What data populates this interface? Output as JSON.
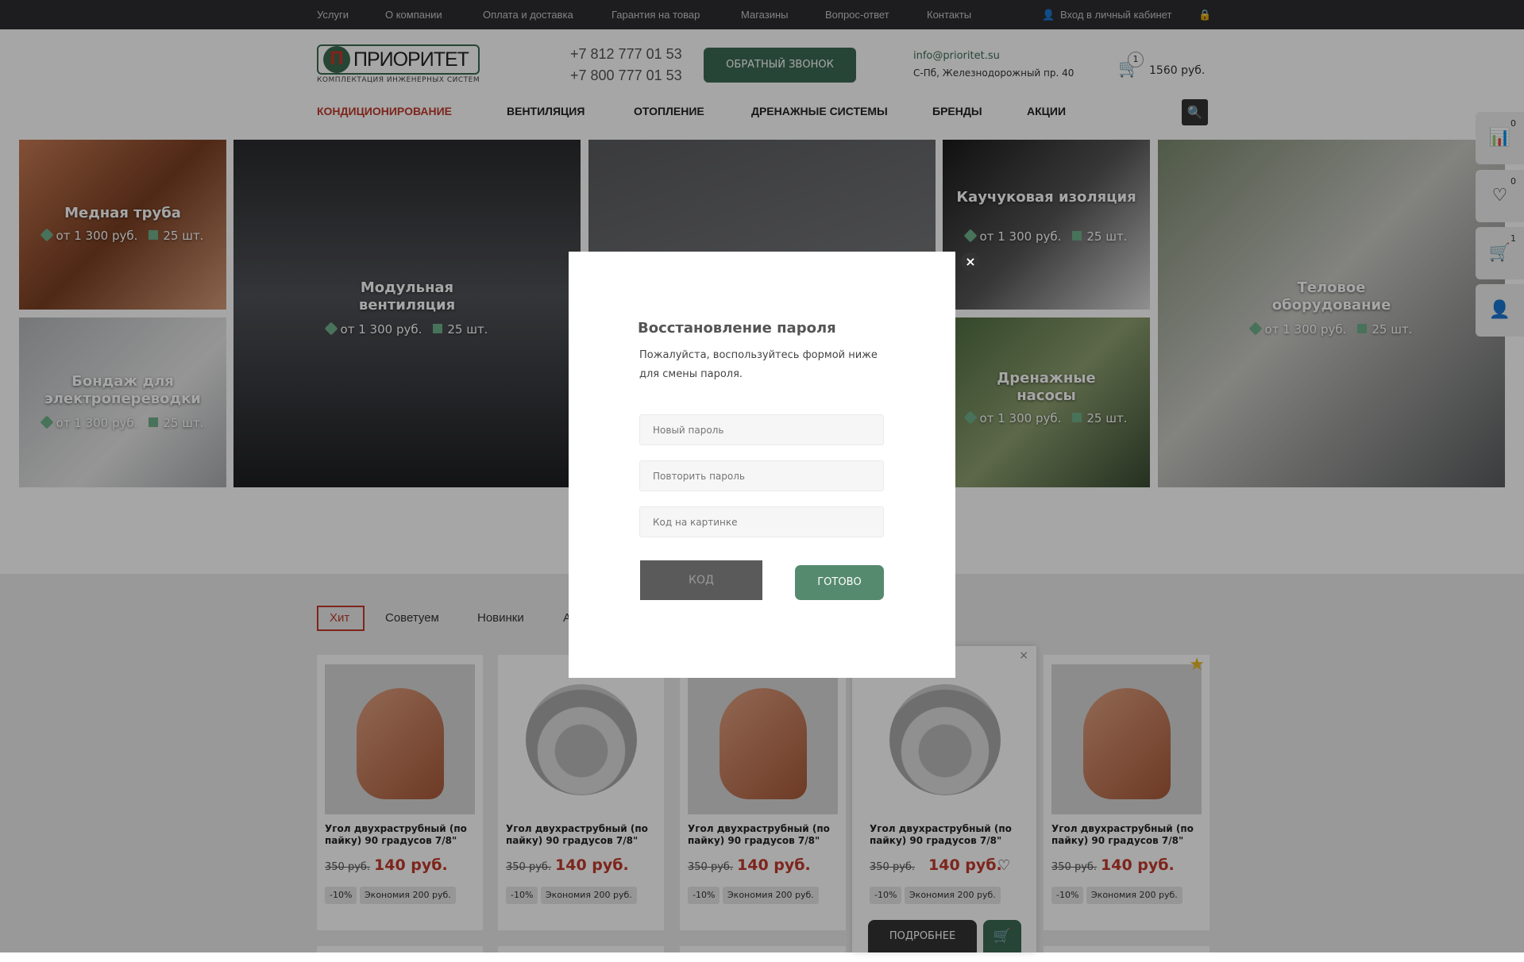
{
  "topbar": {
    "links": [
      "Услуги",
      "О компании",
      "Оплата и доставка",
      "Гарантия на товар",
      "Магазины",
      "Вопрос-ответ",
      "Контакты"
    ],
    "login": "Вход в личный кабинет"
  },
  "header": {
    "logo_mark": "П",
    "logo_text": "ПРИОРИТЕТ",
    "tagline": "КОМПЛЕКТАЦИЯ ИНЖЕНЕРНЫХ СИСТЕМ",
    "phones": [
      "+7 812 777 01 53",
      "+7 800 777 01 53"
    ],
    "callback": "ОБРАТНЫЙ ЗВОНОК",
    "email": "info@prioritet.su",
    "address": "С-Пб, Железнодорожный пр. 40",
    "cart_count": "1",
    "cart_total": "1560 руб."
  },
  "nav": {
    "items": [
      "КОНДИЦИОНИРОВАНИЕ",
      "ВЕНТИЛЯЦИЯ",
      "ОТОПЛЕНИЕ",
      "ДРЕНАЖНЫЕ СИСТЕМЫ",
      "БРЕНДЫ",
      "АКЦИИ"
    ],
    "active_color": "#c0392b"
  },
  "tiles": [
    {
      "title": "Медная труба",
      "price": "от 1 300 руб.",
      "qty": "25 шт."
    },
    {
      "title": "Бондаж для электропереводки",
      "price": "от 1 300 руб.",
      "qty": "25 шт."
    },
    {
      "title": "Модульная вентиляция",
      "price": "от 1 300 руб.",
      "qty": "25 шт."
    },
    {
      "title": "Каучуковая изоляция",
      "price": "от 1 300 руб.",
      "qty": "25 шт."
    },
    {
      "title": "Дренажные насосы",
      "price": "от 1 300 руб.",
      "qty": "25 шт."
    },
    {
      "title": "Теловое оборудование",
      "price": "от 1 300 руб.",
      "qty": "25 шт."
    }
  ],
  "side": {
    "compare_count": "0",
    "favorites_count": "0",
    "cart_count": "1"
  },
  "tabs": [
    "Хит",
    "Советуем",
    "Новинки",
    "А"
  ],
  "products": [
    {
      "name": "Угол двухраструбный (по пайку) 90 градусов 7/8\"",
      "old": "350 руб.",
      "price": "140 руб.",
      "discount": "-10%",
      "saving": "Экономия 200 руб."
    },
    {
      "name": "Угол двухраструбный (по пайку) 90 градусов 7/8\"",
      "old": "350 руб.",
      "price": "140 руб.",
      "discount": "-10%",
      "saving": "Экономия 200 руб."
    },
    {
      "name": "Угол двухраструбный (по пайку) 90 градусов 7/8\"",
      "old": "350 руб.",
      "price": "140 руб.",
      "discount": "-10%",
      "saving": "Экономия 200 руб."
    },
    {
      "name": "Угол двухраструбный (по пайку) 90 градусов 7/8\"",
      "old": "350 руб.",
      "price": "140 руб.",
      "discount": "-10%",
      "saving": "Экономия 200 руб.",
      "details": "ПОДРОБНЕЕ"
    },
    {
      "name": "Угол двухраструбный (по пайку) 90 градусов 7/8\"",
      "old": "350 руб.",
      "price": "140 руб.",
      "discount": "-10%",
      "saving": "Экономия 200 руб."
    }
  ],
  "modal": {
    "title": "Восстановление пароля",
    "text": "Пожалуйста, воспользуйтесь формой ниже для смены пароля.",
    "new_password_placeholder": "Новый пароль",
    "repeat_password_placeholder": "Повторить пароль",
    "captcha_placeholder": "Код на картинке",
    "captcha_label": "КОД",
    "submit": "ГОТОВО"
  }
}
